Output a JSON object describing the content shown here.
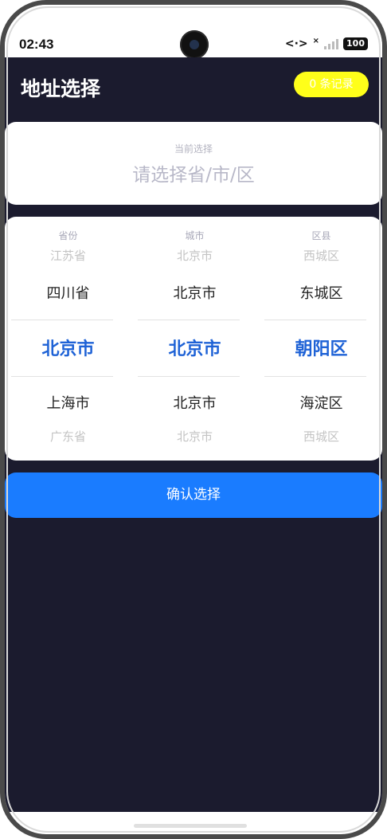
{
  "status_bar": {
    "time": "02:43",
    "signal_icon": "<·>",
    "signal_x": "×",
    "battery": "100"
  },
  "header": {
    "title": "地址选择",
    "records_button": "0 条记录"
  },
  "current_selection": {
    "label": "当前选择",
    "value": "请选择省/市/区"
  },
  "picker": {
    "columns": [
      {
        "header": "省份",
        "items": [
          "江苏省",
          "四川省",
          "北京市",
          "上海市",
          "广东省"
        ]
      },
      {
        "header": "城市",
        "items": [
          "北京市",
          "北京市",
          "北京市",
          "北京市",
          "北京市"
        ]
      },
      {
        "header": "区县",
        "items": [
          "西城区",
          "东城区",
          "朝阳区",
          "海淀区",
          "西城区"
        ]
      }
    ]
  },
  "confirm_button": "确认选择",
  "colors": {
    "background": "#1b1b2e",
    "accent": "#1a7cff",
    "selected_text": "#1e62d6",
    "records_button_bg": "#ffff1a"
  }
}
